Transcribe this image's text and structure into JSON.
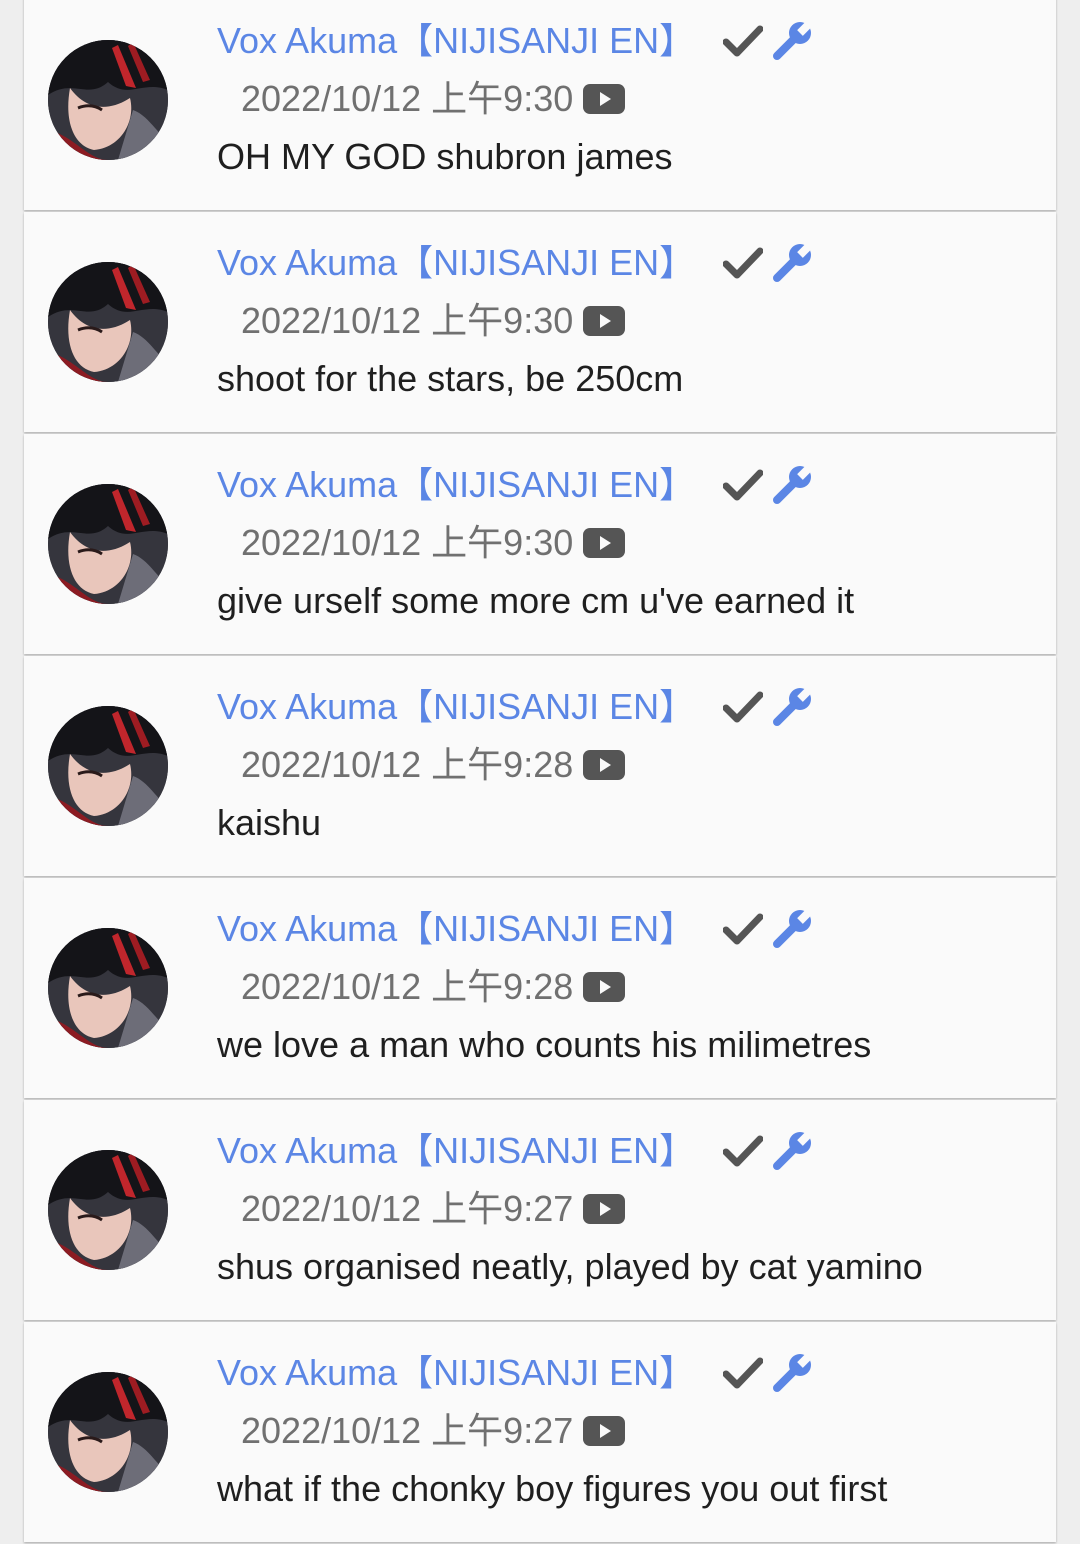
{
  "colors": {
    "author_name": "#5b86e5",
    "timestamp": "#707070",
    "message": "#1f1f1f",
    "check_icon": "#555555",
    "wrench_icon": "#5b86e5",
    "youtube_icon": "#555555",
    "card_background": "#fafafa"
  },
  "icons": {
    "verified": "check-icon",
    "moderator": "wrench-icon",
    "source": "youtube-icon"
  },
  "messages": [
    {
      "author": "Vox Akuma【NIJISANJI EN】",
      "timestamp": "2022/10/12 上午9:30",
      "text": "OH MY GOD shubron james"
    },
    {
      "author": "Vox Akuma【NIJISANJI EN】",
      "timestamp": "2022/10/12 上午9:30",
      "text": "shoot for the stars, be 250cm"
    },
    {
      "author": "Vox Akuma【NIJISANJI EN】",
      "timestamp": "2022/10/12 上午9:30",
      "text": "give urself some more cm u've earned it"
    },
    {
      "author": "Vox Akuma【NIJISANJI EN】",
      "timestamp": "2022/10/12 上午9:28",
      "text": "kaishu"
    },
    {
      "author": "Vox Akuma【NIJISANJI EN】",
      "timestamp": "2022/10/12 上午9:28",
      "text": "we love a man who counts his milimetres"
    },
    {
      "author": "Vox Akuma【NIJISANJI EN】",
      "timestamp": "2022/10/12 上午9:27",
      "text": "shus organised neatly, played by cat yamino"
    },
    {
      "author": "Vox Akuma【NIJISANJI EN】",
      "timestamp": "2022/10/12 上午9:27",
      "text": "what if the chonky boy figures you out first"
    }
  ]
}
